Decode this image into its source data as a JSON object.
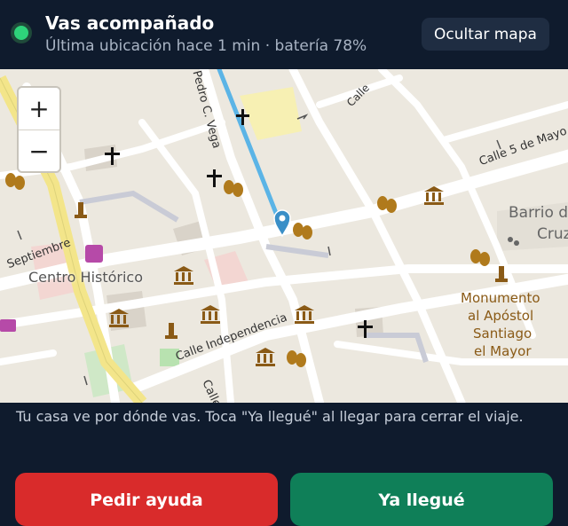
{
  "header": {
    "title": "Vas acompañado",
    "subtitle": "Última ubicación hace 1 min · batería 78%",
    "hide_map_label": "Ocultar mapa",
    "status_color": "#2ed37a"
  },
  "map": {
    "zoom_in_label": "+",
    "zoom_out_label": "−",
    "labels": {
      "centro": "Centro Histórico",
      "barrio_line1": "Barrio d",
      "barrio_line2": "Cruz",
      "monumento_1": "Monumento",
      "monumento_2": "al Apóstol",
      "monumento_3": "Santiago",
      "monumento_4": "el Mayor",
      "calle_independencia": "Calle Independencia",
      "calle_5_mayo": "Calle 5 de Mayo",
      "septiembre": "Septiembre",
      "pedro_vega": "Pedro C. Vega",
      "calle_partial": "Calle",
      "calle_top": "Calle"
    },
    "route_color": "#5bb4e6",
    "marker_color": "#3a8fc7"
  },
  "info_text": "Tu casa ve por dónde vas. Toca \"Ya llegué\" al llegar para cerrar el viaje.",
  "actions": {
    "help_label": "Pedir ayuda",
    "arrived_label": "Ya llegué",
    "help_color": "#d92b2b",
    "arrived_color": "#0f7f58"
  }
}
